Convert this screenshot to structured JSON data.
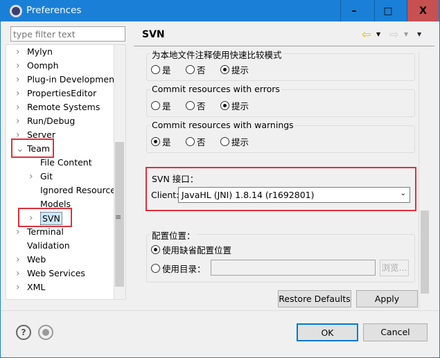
{
  "window": {
    "title": "Preferences",
    "minimize": "–",
    "maximize": "□",
    "close": "X"
  },
  "sidebar": {
    "filter_placeholder": "type filter text",
    "items": [
      {
        "label": "Mylyn",
        "arrow": "›"
      },
      {
        "label": "Oomph",
        "arrow": "›"
      },
      {
        "label": "Plug-in Development",
        "arrow": "›"
      },
      {
        "label": "PropertiesEditor",
        "arrow": "›"
      },
      {
        "label": "Remote Systems",
        "arrow": "›"
      },
      {
        "label": "Run/Debug",
        "arrow": "›"
      },
      {
        "label": "Server",
        "arrow": "›"
      },
      {
        "label": "Team",
        "arrow": "⌄"
      },
      {
        "label": "File Content",
        "arrow": ""
      },
      {
        "label": "Git",
        "arrow": "›"
      },
      {
        "label": "Ignored Resources",
        "arrow": ""
      },
      {
        "label": "Models",
        "arrow": ""
      },
      {
        "label": "SVN",
        "arrow": "›"
      },
      {
        "label": "Terminal",
        "arrow": "›"
      },
      {
        "label": "Validation",
        "arrow": ""
      },
      {
        "label": "Web",
        "arrow": "›"
      },
      {
        "label": "Web Services",
        "arrow": "›"
      },
      {
        "label": "XML",
        "arrow": "›"
      }
    ]
  },
  "page": {
    "title": "SVN",
    "groups": [
      {
        "label": "为本地文件注释使用快速比较模式",
        "options": [
          "是",
          "否",
          "提示"
        ],
        "selected": 2
      },
      {
        "label": "Commit resources with errors",
        "options": [
          "是",
          "否",
          "提示"
        ],
        "selected": 2
      },
      {
        "label": "Commit resources with warnings",
        "options": [
          "是",
          "否",
          "提示"
        ],
        "selected": 0
      }
    ],
    "svn_interface": {
      "label": "SVN 接口：",
      "client_label": "Client:",
      "client_value": "JavaHL (JNI) 1.8.14 (r1692801)"
    },
    "config": {
      "label": "配置位置：",
      "default_option": "使用缺省配置位置",
      "dir_option": "使用目录：",
      "dir_value": "",
      "browse": "浏览..."
    },
    "restore_defaults": "Restore Defaults",
    "apply": "Apply"
  },
  "footer": {
    "ok": "OK",
    "cancel": "Cancel",
    "help": "?"
  }
}
